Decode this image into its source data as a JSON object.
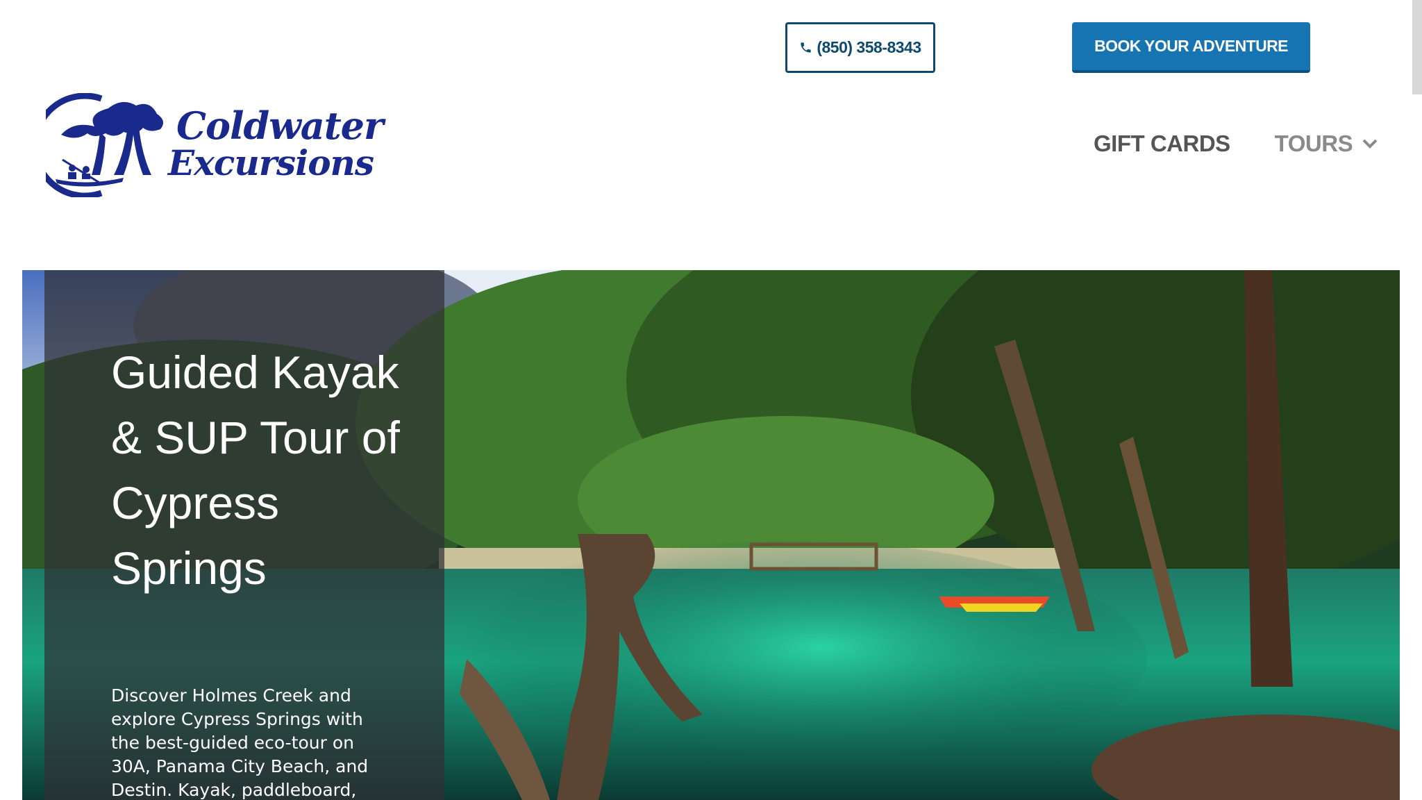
{
  "header": {
    "phone_label": "(850) 358-8343",
    "book_label": "BOOK YOUR ADVENTURE"
  },
  "logo": {
    "line1": "Coldwater",
    "line2": "Excursions"
  },
  "nav": {
    "items": [
      {
        "label": "GIFT CARDS"
      },
      {
        "label": "TOURS"
      }
    ]
  },
  "hero": {
    "title": "Guided Kayak & SUP Tour of Cypress Springs",
    "description": "Discover Holmes Creek and explore Cypress Springs with the best-guided eco-tour on 30A, Panama City Beach, and Destin. Kayak, paddleboard,"
  },
  "colors": {
    "brand_navy": "#1a2a8c",
    "button_blue": "#1574b1",
    "phone_border": "#0e4a6e"
  },
  "icons": {
    "phone": "phone-icon",
    "dropdown": "chevron-down-icon"
  }
}
